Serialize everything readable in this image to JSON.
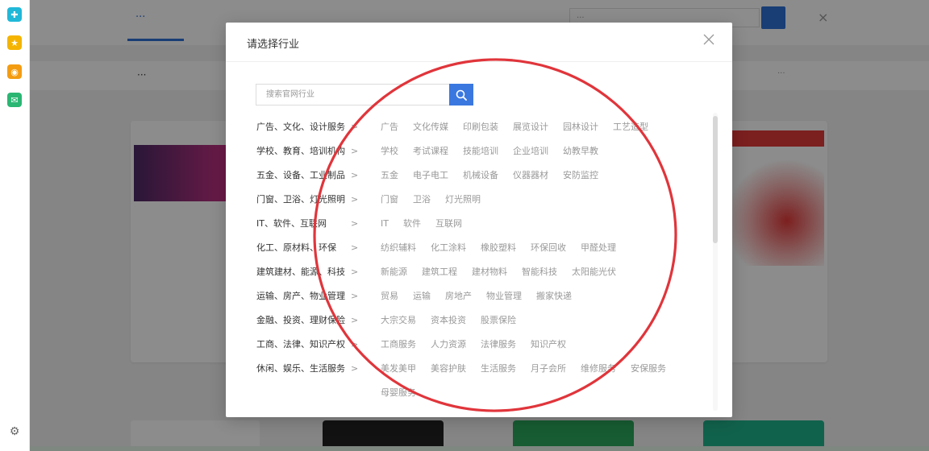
{
  "rail": {
    "icons": [
      "plus-circle-icon",
      "star-icon",
      "weibo-icon",
      "mail-icon",
      "settings-icon"
    ]
  },
  "background_page": {
    "tab_label": "···",
    "filter_label": "···",
    "search_placeholder": "···",
    "filter_right": "···"
  },
  "modal": {
    "title": "请选择行业",
    "search_placeholder": "搜索官网行业",
    "categories": [
      {
        "label": "广告、文化、设计服务",
        "subs": [
          "广告",
          "文化传媒",
          "印刷包装",
          "展览设计",
          "园林设计",
          "工艺造型"
        ]
      },
      {
        "label": "学校、教育、培训机构",
        "subs": [
          "学校",
          "考试课程",
          "技能培训",
          "企业培训",
          "幼教早教"
        ]
      },
      {
        "label": "五金、设备、工业制品",
        "subs": [
          "五金",
          "电子电工",
          "机械设备",
          "仪器器材",
          "安防监控"
        ]
      },
      {
        "label": "门窗、卫浴、灯光照明",
        "subs": [
          "门窗",
          "卫浴",
          "灯光照明"
        ]
      },
      {
        "label": "IT、软件、互联网",
        "subs": [
          "IT",
          "软件",
          "互联网"
        ]
      },
      {
        "label": "化工、原材料、环保",
        "subs": [
          "纺织辅料",
          "化工涂料",
          "橡胶塑料",
          "环保回收",
          "甲醛处理"
        ]
      },
      {
        "label": "建筑建材、能源、科技",
        "subs": [
          "新能源",
          "建筑工程",
          "建材物料",
          "智能科技",
          "太阳能光伏"
        ]
      },
      {
        "label": "运输、房产、物业管理",
        "subs": [
          "贸易",
          "运输",
          "房地产",
          "物业管理",
          "搬家快递"
        ]
      },
      {
        "label": "金融、投资、理财保险",
        "subs": [
          "大宗交易",
          "资本投资",
          "股票保险"
        ]
      },
      {
        "label": "工商、法律、知识产权",
        "subs": [
          "工商服务",
          "人力资源",
          "法律服务",
          "知识产权"
        ]
      },
      {
        "label": "休闲、娱乐、生活服务",
        "subs": [
          "美发美甲",
          "美容护肤",
          "生活服务",
          "月子会所",
          "维修服务",
          "安保服务",
          "母婴服务"
        ]
      }
    ]
  },
  "colors": {
    "accent": "#3a78e0",
    "annotation": "#e0353b"
  }
}
